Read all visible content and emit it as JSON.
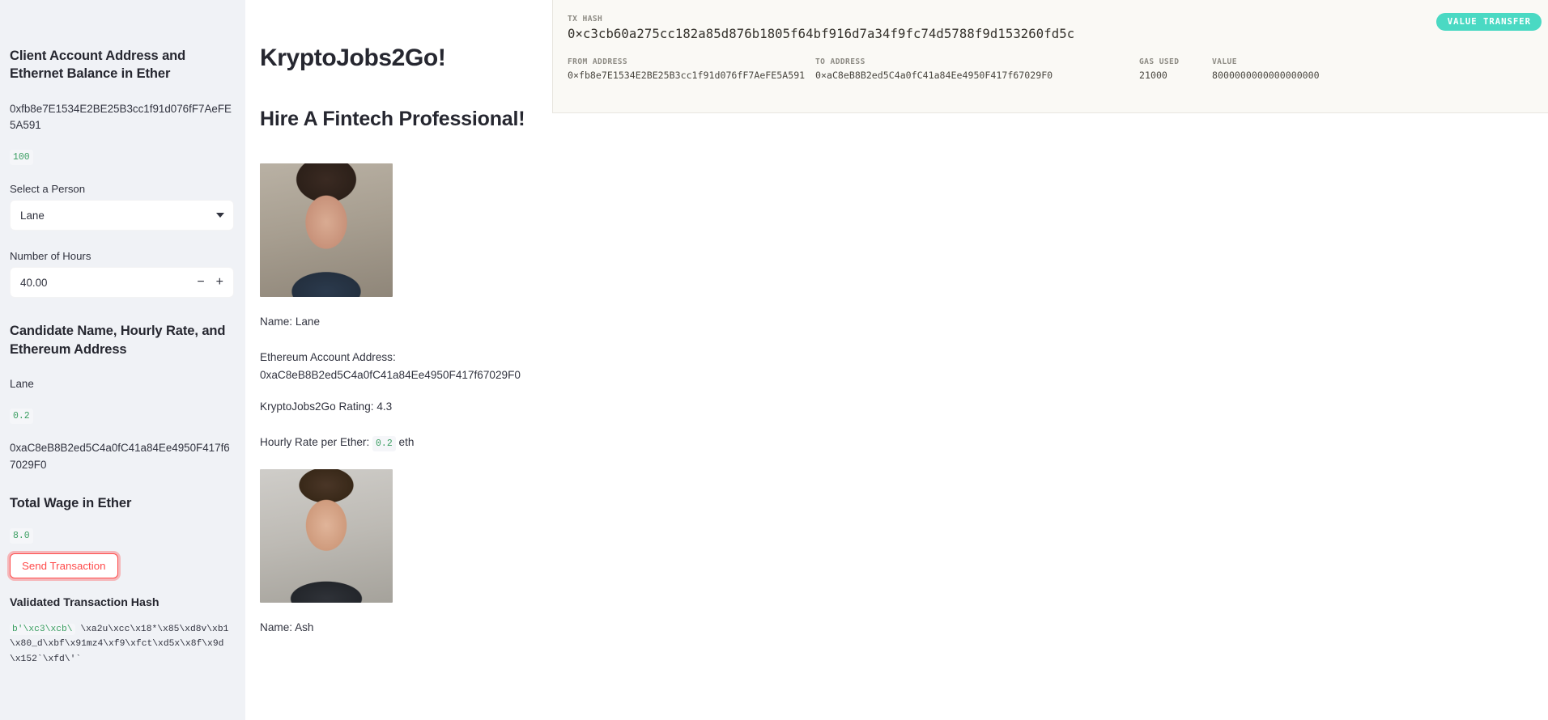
{
  "sidebar": {
    "heading_client": "Client Account Address and Ethernet Balance in Ether",
    "client_address": "0xfb8e7E1534E2BE25B3cc1f91d076fF7AeFE5A591",
    "client_balance": "100",
    "select_label": "Select a Person",
    "selected_person": "Lane",
    "hours_label": "Number of Hours",
    "hours_value": "40.00",
    "stepper_minus": "−",
    "stepper_plus": "+",
    "heading_candidate": "Candidate Name, Hourly Rate, and Ethereum Address",
    "candidate_name": "Lane",
    "candidate_rate": "0.2",
    "candidate_address": "0xaC8eB8B2ed5C4a0fC41a84Ee4950F417f67029F0",
    "heading_total_wage": "Total Wage in Ether",
    "total_wage": "8.0",
    "send_button": "Send Transaction",
    "heading_validated_hash": "Validated Transaction Hash",
    "validated_hash_prefix": "b'\\xc3\\xcb\\",
    "validated_hash_rest": " \\xa2u\\xcc\\x18*\\x85\\xd8v\\xb1\\x80_d\\xbf\\x91mz4\\xf9\\xfct\\xd5x\\x8f\\x9d\\x152`\\xfd\\'`"
  },
  "main": {
    "title": "KryptoJobs2Go!",
    "subtitle": "Hire A Fintech Professional!",
    "candidates": [
      {
        "photo": "lane-headshot",
        "name_line": "Name: Lane",
        "address_label": "Ethereum Account Address:",
        "address_value": "0xaC8eB8B2ed5C4a0fC41a84Ee4950F417f67029F0",
        "rating_line": "KryptoJobs2Go Rating: 4.3",
        "rate_label": "Hourly Rate per Ether:",
        "rate_value": "0.2",
        "rate_unit": "eth"
      },
      {
        "photo": "ash-headshot",
        "name_line": "Name: Ash"
      }
    ]
  },
  "transaction": {
    "tx_hash_label": "TX HASH",
    "tx_hash_value": "0×c3cb60a275cc182a85d876b1805f64bf916d7a34f9fc74d5788f9d153260fd5c",
    "badge_label": "VALUE TRANSFER",
    "from_label": "FROM ADDRESS",
    "from_value": "0×fb8e7E1534E2BE25B3cc1f91d076fF7AeFE5A591",
    "to_label": "TO ADDRESS",
    "to_value": "0×aC8eB8B2ed5C4a0fC41a84Ee4950F417f67029F0",
    "gas_label": "GAS USED",
    "gas_value": "21000",
    "value_label": "VALUE",
    "value_value": "8000000000000000000"
  },
  "colors": {
    "accent_red": "#ff4b4b",
    "badge_teal": "#4ad9c3",
    "code_green": "#3a9e61",
    "sidebar_bg": "#f0f2f6",
    "tx_panel_bg": "#faf9f5"
  }
}
